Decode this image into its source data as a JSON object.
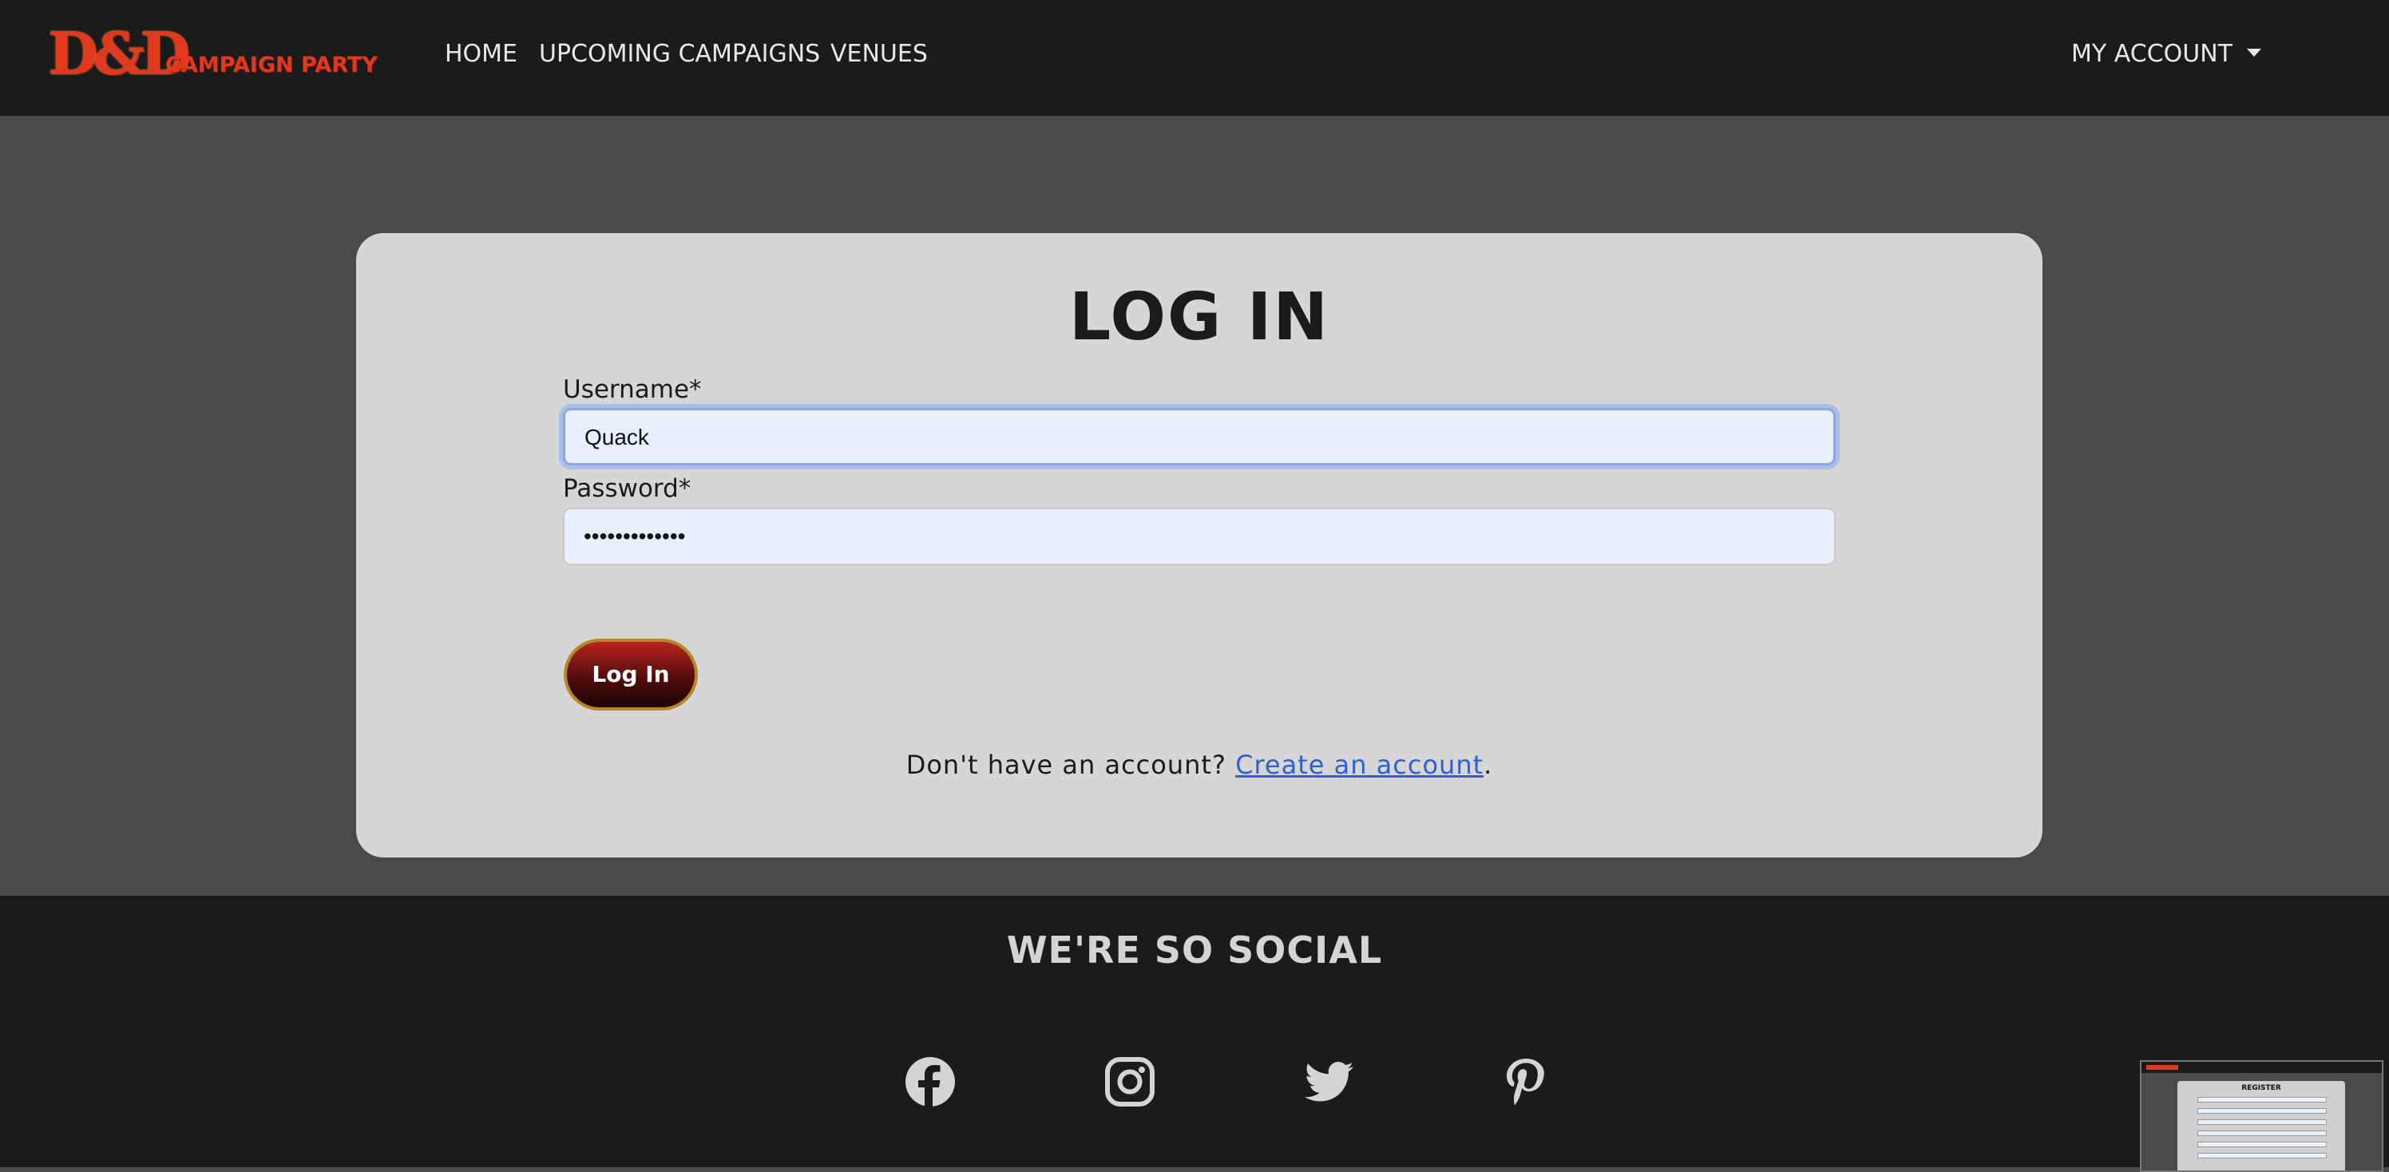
{
  "nav": {
    "brand_logo": "D&D",
    "brand_text": "CAMPAIGN PARTY",
    "links": [
      "HOME",
      "UPCOMING CAMPAIGNS",
      "VENUES"
    ],
    "account": "MY ACCOUNT"
  },
  "login": {
    "title": "LOG IN",
    "username_label": "Username*",
    "username_value": "Quack",
    "password_label": "Password*",
    "password_value": "•••••••••••••",
    "submit_label": "Log In",
    "signup_prefix": "Don't have an account?",
    "signup_link": "Create an account",
    "signup_suffix": "."
  },
  "footer": {
    "title": "WE'RE SO SOCIAL",
    "social_icons": [
      "facebook-icon",
      "instagram-icon",
      "twitter-icon",
      "pinterest-icon"
    ]
  },
  "thumbnail": {
    "title": "REGISTER"
  },
  "colors": {
    "navbar_bg": "#1b1b1b",
    "page_bg": "#4a4a4a",
    "card_bg": "#d6d6d6",
    "brand": "#e0391e",
    "link": "#2f5fd8",
    "button_border": "#b58a26"
  }
}
